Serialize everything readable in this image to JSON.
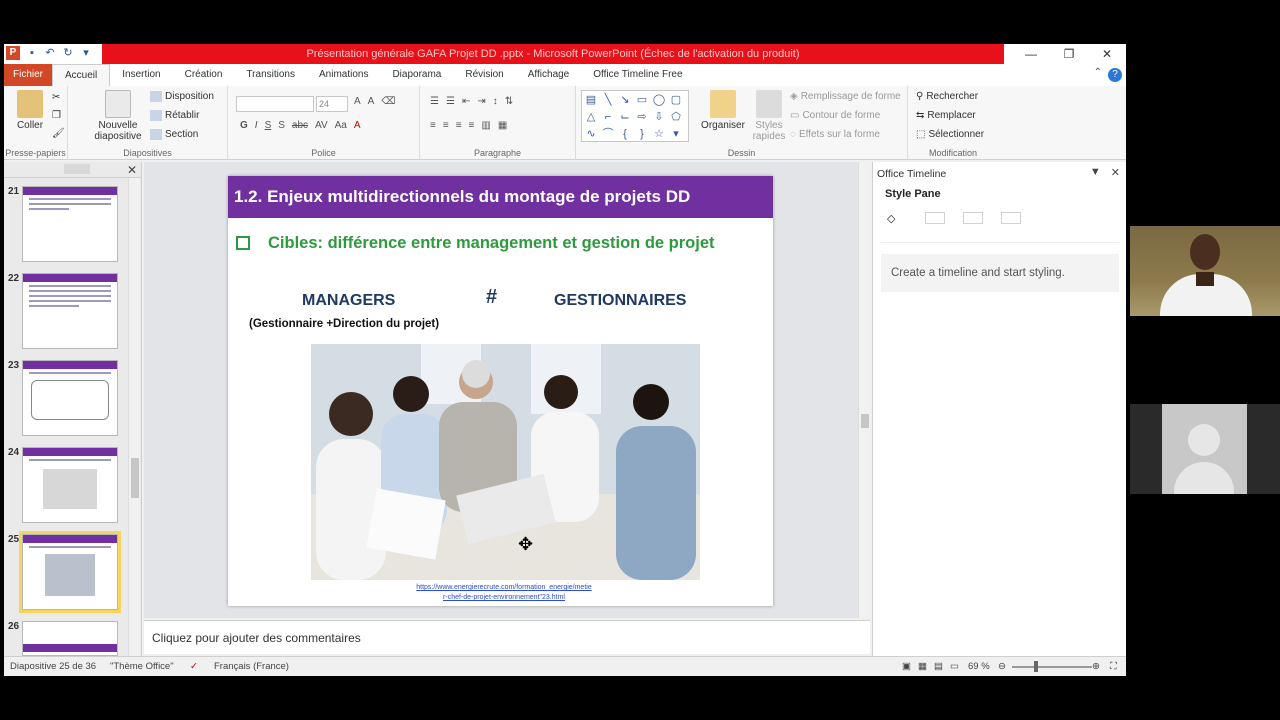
{
  "window": {
    "title": "Présentation générale GAFA Projet DD .pptx - Microsoft PowerPoint (Échec de l'activation du produit)",
    "controls": [
      "—",
      "❐",
      "✕"
    ]
  },
  "ribbon_tabs": [
    "Fichier",
    "Accueil",
    "Insertion",
    "Création",
    "Transitions",
    "Animations",
    "Diaporama",
    "Révision",
    "Affichage",
    "Office Timeline Free"
  ],
  "ribbon": {
    "clipboard": {
      "paste_label": "Coller",
      "group_label": "Presse-papiers"
    },
    "slides": {
      "new_slide_label": "Nouvelle diapositive",
      "layout": "Disposition",
      "reset": "Rétablir",
      "section": "Section",
      "group_label": "Diapositives"
    },
    "font": {
      "size": "24",
      "group_label": "Police",
      "format_buttons": [
        "G",
        "I",
        "S",
        "S",
        "abc",
        "AV",
        "Aa",
        "A"
      ]
    },
    "paragraph": {
      "group_label": "Paragraphe"
    },
    "drawing": {
      "organize": "Organiser",
      "quick_styles": "Styles rapides",
      "fill": "Remplissage de forme",
      "outline": "Contour de forme",
      "effects": "Effets sur la forme",
      "group_label": "Dessin"
    },
    "editing": {
      "find": "Rechercher",
      "replace": "Remplacer",
      "select": "Sélectionner",
      "group_label": "Modification"
    }
  },
  "thumbnails": [
    {
      "number": "21"
    },
    {
      "number": "22"
    },
    {
      "number": "23"
    },
    {
      "number": "24"
    },
    {
      "number": "25",
      "selected": true
    },
    {
      "number": "26"
    }
  ],
  "slide": {
    "title": "1.2. Enjeux multidirectionnels du montage de projets DD",
    "bullet": "Cibles: différence entre management et gestion de projet",
    "left_heading": "MANAGERS",
    "hash": "#",
    "right_heading": "GESTIONNAIRES",
    "subheading": "(Gestionnaire +Direction du projet)",
    "link_line1": "https://www.energierecrute.com/formation_energie/metie",
    "link_line2": "r-chef-de-projet-environnement\"23.html",
    "accent_color": "#7030a0",
    "bullet_color": "#2e9a3e"
  },
  "notes": {
    "placeholder": "Cliquez pour ajouter des commentaires"
  },
  "timeline_pane": {
    "header": "Office Timeline",
    "style_pane": "Style Pane",
    "message": "Create a timeline and start styling."
  },
  "status": {
    "slide_info": "Diapositive 25 de 36",
    "theme": "\"Thème Office\"",
    "language": "Français (France)",
    "zoom": "69 %"
  }
}
